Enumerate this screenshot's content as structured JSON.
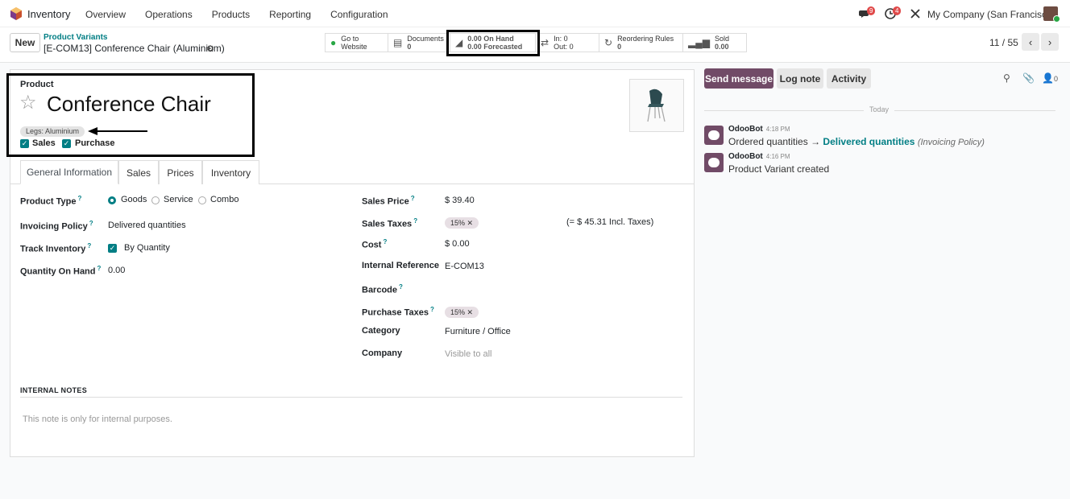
{
  "navbar": {
    "app_name": "Inventory",
    "menu": [
      "Overview",
      "Operations",
      "Products",
      "Reporting",
      "Configuration"
    ],
    "chat_badge": "9",
    "activity_badge": "4",
    "company": "My Company (San Francisco)"
  },
  "control": {
    "new_label": "New",
    "breadcrumb_parent": "Product Variants",
    "breadcrumb_current": "[E-COM13] Conference Chair (Aluminium)",
    "pager": "11 / 55"
  },
  "smart_buttons": {
    "website_l1": "Go to",
    "website_l2": "Website",
    "documents_label": "Documents",
    "documents_value": "0",
    "onhand_l1": "0.00 On Hand",
    "onhand_l2": "0.00 Forecasted",
    "in_label": "In: 0",
    "out_label": "Out: 0",
    "reorder_label": "Reordering Rules",
    "reorder_value": "0",
    "sold_label": "Sold",
    "sold_value": "0.00"
  },
  "product": {
    "label": "Product",
    "name": "Conference Chair",
    "attribute_tag": "Legs: Aluminium",
    "sales_label": "Sales",
    "purchase_label": "Purchase"
  },
  "tabs": [
    "General Information",
    "Sales",
    "Prices",
    "Inventory"
  ],
  "left_fields": {
    "product_type_label": "Product Type",
    "type_goods": "Goods",
    "type_service": "Service",
    "type_combo": "Combo",
    "invoicing_label": "Invoicing Policy",
    "invoicing_value": "Delivered quantities",
    "track_label": "Track Inventory",
    "track_value": "By Quantity",
    "qty_label": "Quantity On Hand",
    "qty_value": "0.00"
  },
  "right_fields": {
    "sales_price_label": "Sales Price",
    "sales_price_value": "$ 39.40",
    "sales_taxes_label": "Sales Taxes",
    "sales_taxes_tag": "15%",
    "incl_taxes": "(= $ 45.31 Incl. Taxes)",
    "cost_label": "Cost",
    "cost_value": "$ 0.00",
    "internal_ref_label": "Internal Reference",
    "internal_ref_value": "E-COM13",
    "barcode_label": "Barcode",
    "purchase_taxes_label": "Purchase Taxes",
    "purchase_taxes_tag": "15%",
    "category_label": "Category",
    "category_value": "Furniture / Office",
    "company_label": "Company",
    "company_placeholder": "Visible to all"
  },
  "notes": {
    "heading": "INTERNAL NOTES",
    "placeholder": "This note is only for internal purposes."
  },
  "chatter": {
    "send_label": "Send message",
    "log_label": "Log note",
    "activity_label": "Activity",
    "followers_count": "0",
    "today_label": "Today",
    "messages": [
      {
        "author": "OdooBot",
        "time": "4:18 PM",
        "from": "Ordered quantities",
        "to": "Delivered quantities",
        "field": "(Invoicing Policy)"
      },
      {
        "author": "OdooBot",
        "time": "4:16 PM",
        "text": "Product Variant created"
      }
    ]
  },
  "colors": {
    "accent": "#017e84",
    "brand": "#714b67",
    "badge": "#e04a4a"
  }
}
